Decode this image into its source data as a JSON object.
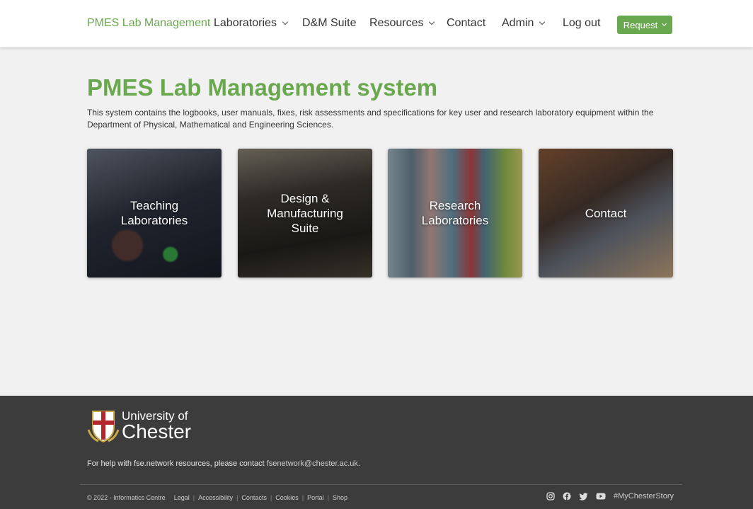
{
  "nav": {
    "brand": "PMES Lab Management",
    "items": [
      {
        "label": "Laboratories",
        "dropdown": true
      },
      {
        "label": "D&M Suite",
        "dropdown": false
      },
      {
        "label": "Resources",
        "dropdown": true
      },
      {
        "label": "Contact",
        "dropdown": false
      },
      {
        "label": "Admin",
        "dropdown": true
      },
      {
        "label": "Log out",
        "dropdown": false
      }
    ],
    "request_label": "Request"
  },
  "main": {
    "title": "PMES Lab Management system",
    "intro": "This system contains the logbooks, user manuals, fixes, risk assessments and specifications for key user and research laboratory equipment within the Department of Physical, Mathematical and Engineering Sciences.",
    "tiles": [
      {
        "label": "Teaching Laboratories"
      },
      {
        "label": "Design & Manufacturing Suite"
      },
      {
        "label": "Research Laboratories"
      },
      {
        "label": "Contact"
      }
    ]
  },
  "footer": {
    "logo_line1": "University of",
    "logo_line2": "Chester",
    "help_text": "For help with fse.network resources, please contact ",
    "help_email": "fsenetwork@chester.ac.uk",
    "help_end": ".",
    "copyright": "© 2022 - Informatics Centre",
    "links": [
      "Legal",
      "Accessibility",
      "Contacts",
      "Cookies",
      "Portal",
      "Shop"
    ],
    "hashtag": "#MyChesterStory",
    "social_icons": [
      "instagram-icon",
      "facebook-icon",
      "twitter-icon",
      "youtube-icon"
    ]
  },
  "colors": {
    "accent": "#6aa84f",
    "footer_bg": "#3c3c3c",
    "page_bg": "#f1f1f1"
  }
}
